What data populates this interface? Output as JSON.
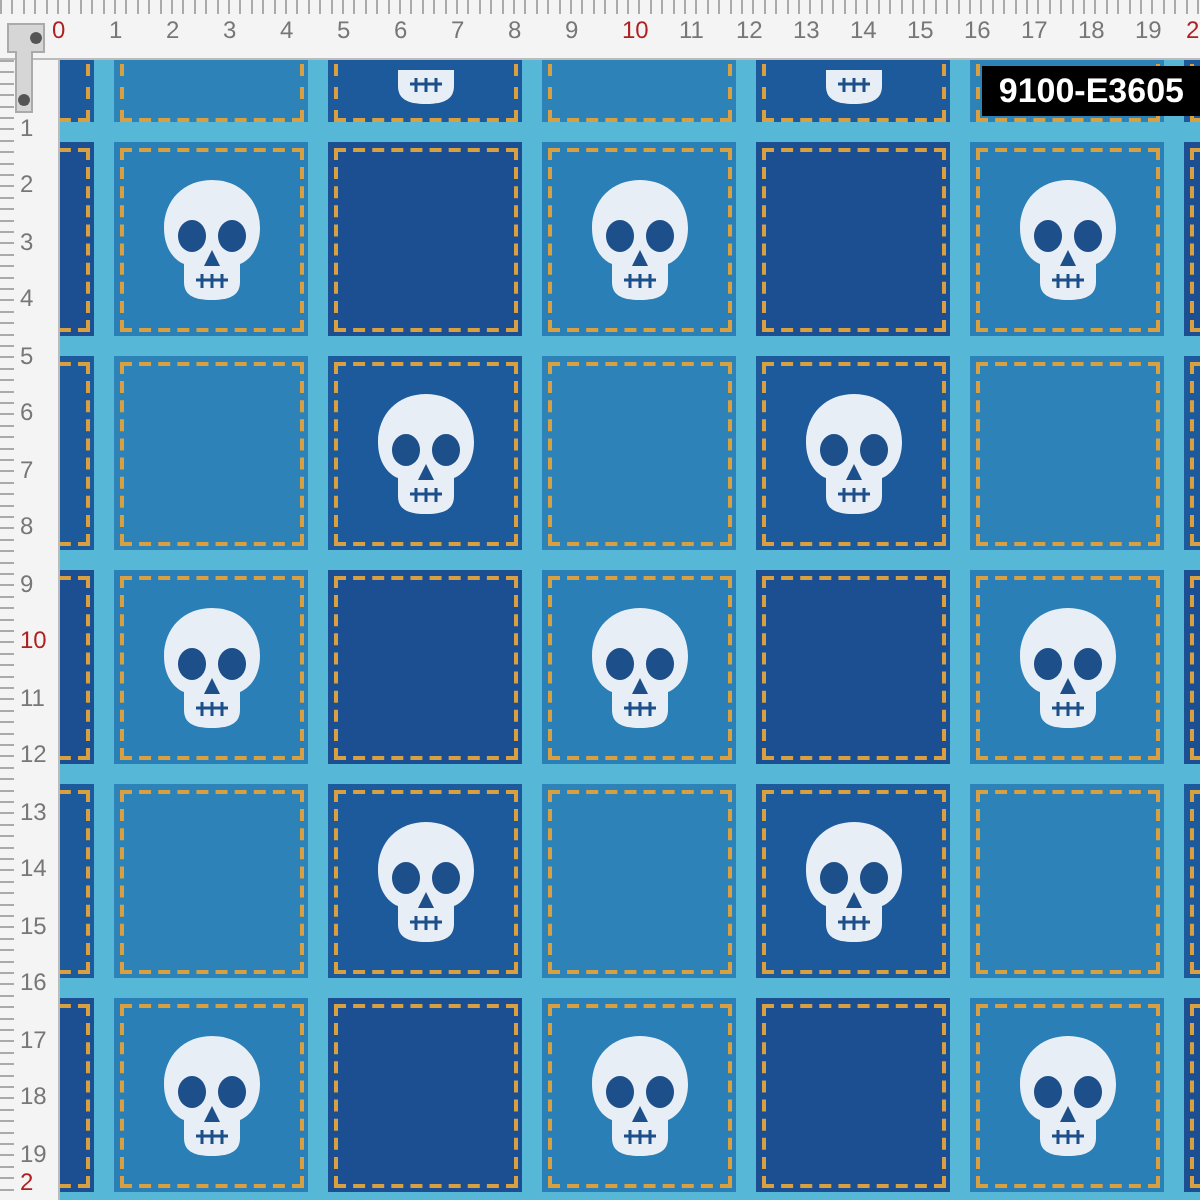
{
  "top_ruler": {
    "labels": [
      {
        "text": "0",
        "highlight": true
      },
      {
        "text": "1",
        "highlight": false
      },
      {
        "text": "2",
        "highlight": false
      },
      {
        "text": "3",
        "highlight": false
      },
      {
        "text": "4",
        "highlight": false
      },
      {
        "text": "5",
        "highlight": false
      },
      {
        "text": "6",
        "highlight": false
      },
      {
        "text": "7",
        "highlight": false
      },
      {
        "text": "8",
        "highlight": false
      },
      {
        "text": "9",
        "highlight": false
      },
      {
        "text": "10",
        "highlight": true
      },
      {
        "text": "11",
        "highlight": false
      },
      {
        "text": "12",
        "highlight": false
      },
      {
        "text": "13",
        "highlight": false
      },
      {
        "text": "14",
        "highlight": false
      },
      {
        "text": "15",
        "highlight": false
      },
      {
        "text": "16",
        "highlight": false
      },
      {
        "text": "17",
        "highlight": false
      },
      {
        "text": "18",
        "highlight": false
      },
      {
        "text": "19",
        "highlight": false
      },
      {
        "text": "2",
        "highlight": true
      }
    ]
  },
  "left_ruler": {
    "labels": [
      {
        "text": "1",
        "highlight": false
      },
      {
        "text": "2",
        "highlight": false
      },
      {
        "text": "3",
        "highlight": false
      },
      {
        "text": "4",
        "highlight": false
      },
      {
        "text": "5",
        "highlight": false
      },
      {
        "text": "6",
        "highlight": false
      },
      {
        "text": "7",
        "highlight": false
      },
      {
        "text": "8",
        "highlight": false
      },
      {
        "text": "9",
        "highlight": false
      },
      {
        "text": "10",
        "highlight": true
      },
      {
        "text": "11",
        "highlight": false
      },
      {
        "text": "12",
        "highlight": false
      },
      {
        "text": "13",
        "highlight": false
      },
      {
        "text": "14",
        "highlight": false
      },
      {
        "text": "15",
        "highlight": false
      },
      {
        "text": "16",
        "highlight": false
      },
      {
        "text": "17",
        "highlight": false
      },
      {
        "text": "18",
        "highlight": false
      },
      {
        "text": "19",
        "highlight": false
      },
      {
        "text": "2",
        "highlight": true
      }
    ]
  },
  "product_code": "9100-E3605"
}
